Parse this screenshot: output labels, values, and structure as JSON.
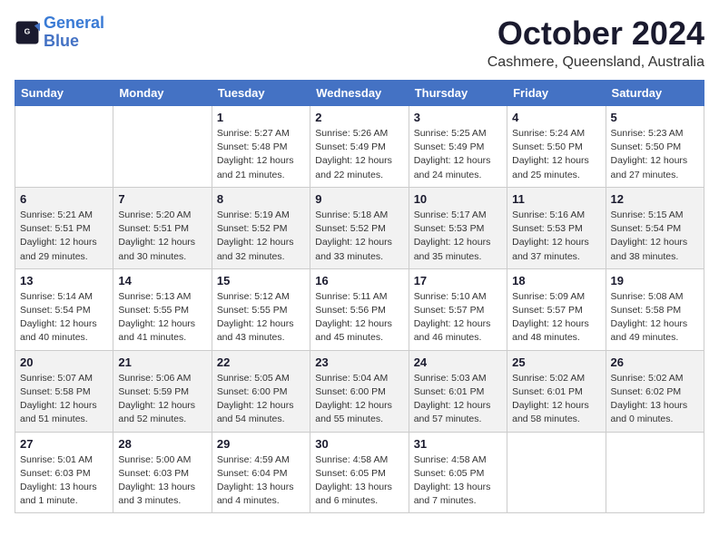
{
  "logo": {
    "line1": "General",
    "line2": "Blue"
  },
  "title": "October 2024",
  "subtitle": "Cashmere, Queensland, Australia",
  "days_header": [
    "Sunday",
    "Monday",
    "Tuesday",
    "Wednesday",
    "Thursday",
    "Friday",
    "Saturday"
  ],
  "weeks": [
    [
      {
        "day": "",
        "info": ""
      },
      {
        "day": "",
        "info": ""
      },
      {
        "day": "1",
        "info": "Sunrise: 5:27 AM\nSunset: 5:48 PM\nDaylight: 12 hours and 21 minutes."
      },
      {
        "day": "2",
        "info": "Sunrise: 5:26 AM\nSunset: 5:49 PM\nDaylight: 12 hours and 22 minutes."
      },
      {
        "day": "3",
        "info": "Sunrise: 5:25 AM\nSunset: 5:49 PM\nDaylight: 12 hours and 24 minutes."
      },
      {
        "day": "4",
        "info": "Sunrise: 5:24 AM\nSunset: 5:50 PM\nDaylight: 12 hours and 25 minutes."
      },
      {
        "day": "5",
        "info": "Sunrise: 5:23 AM\nSunset: 5:50 PM\nDaylight: 12 hours and 27 minutes."
      }
    ],
    [
      {
        "day": "6",
        "info": "Sunrise: 5:21 AM\nSunset: 5:51 PM\nDaylight: 12 hours and 29 minutes."
      },
      {
        "day": "7",
        "info": "Sunrise: 5:20 AM\nSunset: 5:51 PM\nDaylight: 12 hours and 30 minutes."
      },
      {
        "day": "8",
        "info": "Sunrise: 5:19 AM\nSunset: 5:52 PM\nDaylight: 12 hours and 32 minutes."
      },
      {
        "day": "9",
        "info": "Sunrise: 5:18 AM\nSunset: 5:52 PM\nDaylight: 12 hours and 33 minutes."
      },
      {
        "day": "10",
        "info": "Sunrise: 5:17 AM\nSunset: 5:53 PM\nDaylight: 12 hours and 35 minutes."
      },
      {
        "day": "11",
        "info": "Sunrise: 5:16 AM\nSunset: 5:53 PM\nDaylight: 12 hours and 37 minutes."
      },
      {
        "day": "12",
        "info": "Sunrise: 5:15 AM\nSunset: 5:54 PM\nDaylight: 12 hours and 38 minutes."
      }
    ],
    [
      {
        "day": "13",
        "info": "Sunrise: 5:14 AM\nSunset: 5:54 PM\nDaylight: 12 hours and 40 minutes."
      },
      {
        "day": "14",
        "info": "Sunrise: 5:13 AM\nSunset: 5:55 PM\nDaylight: 12 hours and 41 minutes."
      },
      {
        "day": "15",
        "info": "Sunrise: 5:12 AM\nSunset: 5:55 PM\nDaylight: 12 hours and 43 minutes."
      },
      {
        "day": "16",
        "info": "Sunrise: 5:11 AM\nSunset: 5:56 PM\nDaylight: 12 hours and 45 minutes."
      },
      {
        "day": "17",
        "info": "Sunrise: 5:10 AM\nSunset: 5:57 PM\nDaylight: 12 hours and 46 minutes."
      },
      {
        "day": "18",
        "info": "Sunrise: 5:09 AM\nSunset: 5:57 PM\nDaylight: 12 hours and 48 minutes."
      },
      {
        "day": "19",
        "info": "Sunrise: 5:08 AM\nSunset: 5:58 PM\nDaylight: 12 hours and 49 minutes."
      }
    ],
    [
      {
        "day": "20",
        "info": "Sunrise: 5:07 AM\nSunset: 5:58 PM\nDaylight: 12 hours and 51 minutes."
      },
      {
        "day": "21",
        "info": "Sunrise: 5:06 AM\nSunset: 5:59 PM\nDaylight: 12 hours and 52 minutes."
      },
      {
        "day": "22",
        "info": "Sunrise: 5:05 AM\nSunset: 6:00 PM\nDaylight: 12 hours and 54 minutes."
      },
      {
        "day": "23",
        "info": "Sunrise: 5:04 AM\nSunset: 6:00 PM\nDaylight: 12 hours and 55 minutes."
      },
      {
        "day": "24",
        "info": "Sunrise: 5:03 AM\nSunset: 6:01 PM\nDaylight: 12 hours and 57 minutes."
      },
      {
        "day": "25",
        "info": "Sunrise: 5:02 AM\nSunset: 6:01 PM\nDaylight: 12 hours and 58 minutes."
      },
      {
        "day": "26",
        "info": "Sunrise: 5:02 AM\nSunset: 6:02 PM\nDaylight: 13 hours and 0 minutes."
      }
    ],
    [
      {
        "day": "27",
        "info": "Sunrise: 5:01 AM\nSunset: 6:03 PM\nDaylight: 13 hours and 1 minute."
      },
      {
        "day": "28",
        "info": "Sunrise: 5:00 AM\nSunset: 6:03 PM\nDaylight: 13 hours and 3 minutes."
      },
      {
        "day": "29",
        "info": "Sunrise: 4:59 AM\nSunset: 6:04 PM\nDaylight: 13 hours and 4 minutes."
      },
      {
        "day": "30",
        "info": "Sunrise: 4:58 AM\nSunset: 6:05 PM\nDaylight: 13 hours and 6 minutes."
      },
      {
        "day": "31",
        "info": "Sunrise: 4:58 AM\nSunset: 6:05 PM\nDaylight: 13 hours and 7 minutes."
      },
      {
        "day": "",
        "info": ""
      },
      {
        "day": "",
        "info": ""
      }
    ]
  ]
}
